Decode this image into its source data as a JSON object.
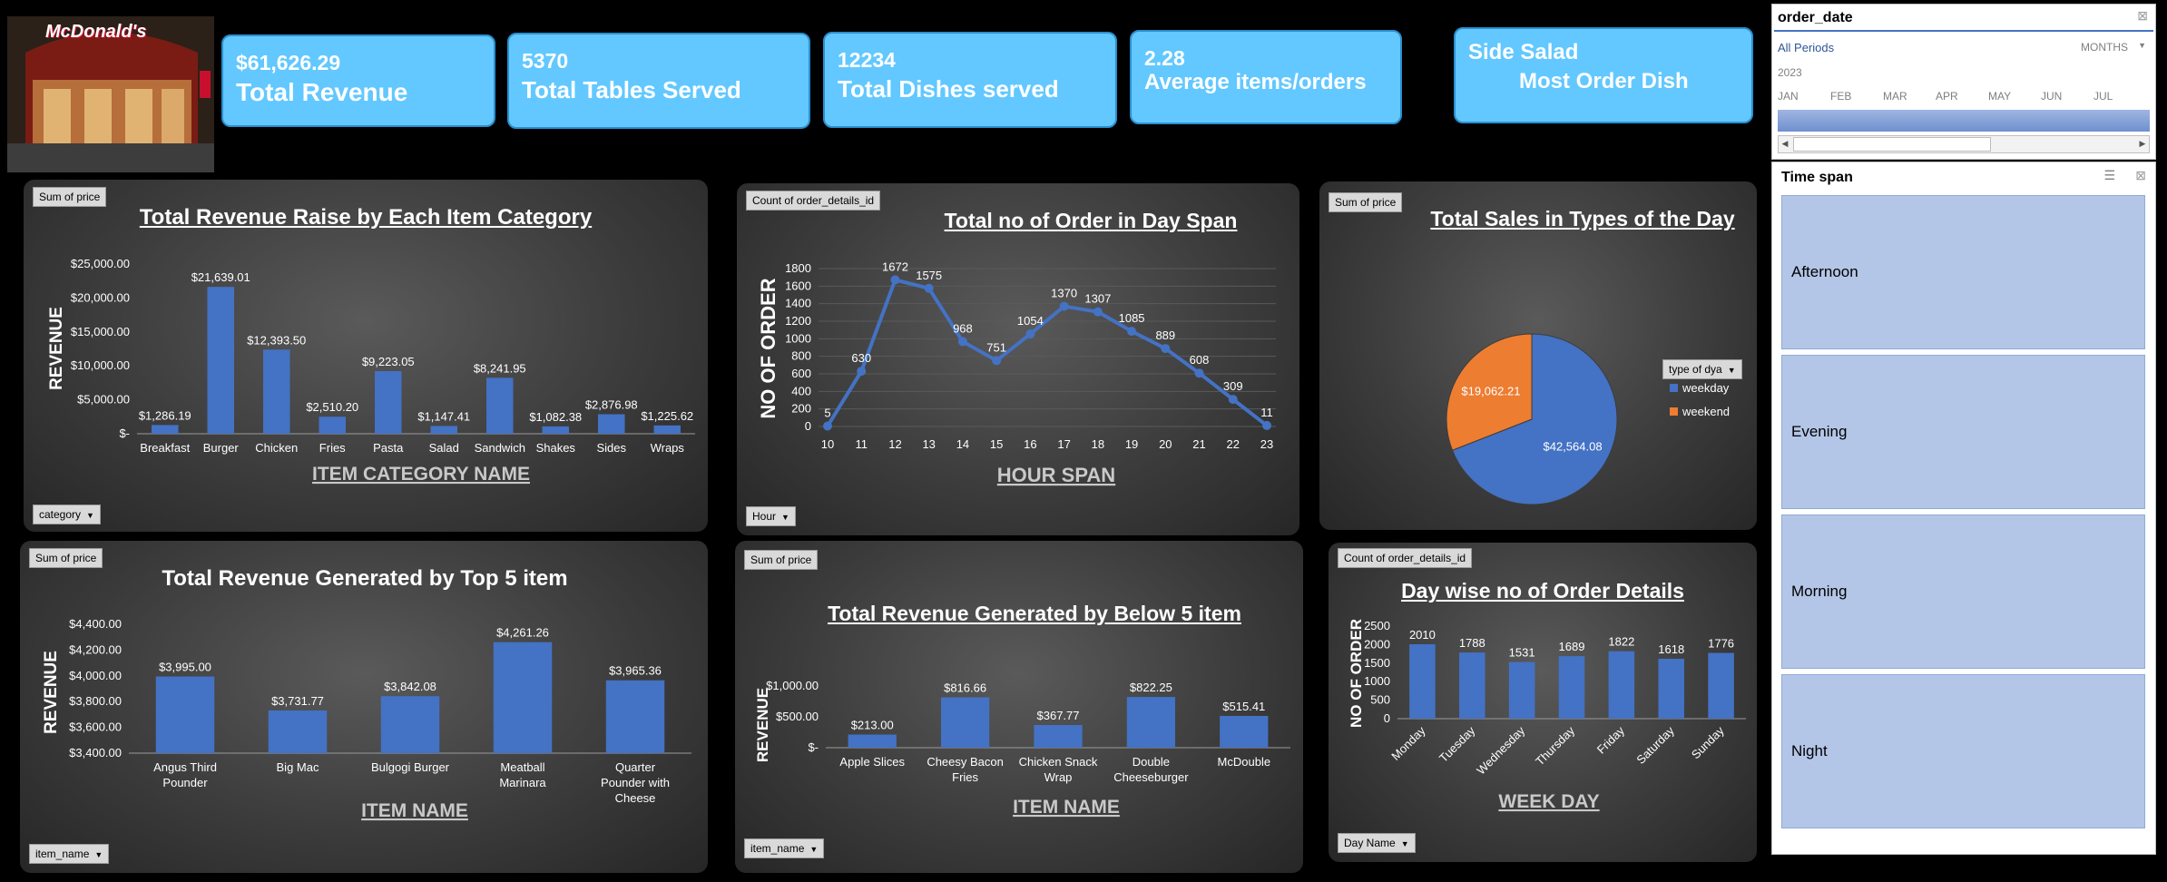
{
  "kpis": [
    {
      "value": "$61,626.29",
      "label": "Total Revenue"
    },
    {
      "value": "5370",
      "label": "Total Tables Served"
    },
    {
      "value": "12234",
      "label": "Total Dishes served"
    },
    {
      "value": "2.28",
      "label": "Average items/orders"
    },
    {
      "value": "Side Salad",
      "label": "Most Order Dish"
    }
  ],
  "logo_text": "McDonald's",
  "timeline": {
    "field": "order_date",
    "all_periods": "All Periods",
    "level": "MONTHS",
    "year": "2023",
    "months": [
      "JAN",
      "FEB",
      "MAR",
      "APR",
      "MAY",
      "JUN",
      "JUL"
    ]
  },
  "slicer": {
    "title": "Time span",
    "items": [
      "Afternoon",
      "Evening",
      "Morning",
      "Night"
    ]
  },
  "colors": {
    "bar": "#4472c4",
    "weekday": "#4472c4",
    "weekend": "#ed7d31",
    "kpi": "#62c8ff",
    "slicer_tile": "#b4c6e7"
  },
  "chart_data": [
    {
      "id": "category",
      "type": "bar",
      "field_button": "Sum of price",
      "axis_button": "category",
      "title": "Total Revenue  Raise by Each Item Category",
      "xlabel": "ITEM CATEGORY NAME",
      "ylabel": "REVENUE",
      "categories": [
        "Breakfast",
        "Burger",
        "Chicken",
        "Fries",
        "Pasta",
        "Salad",
        "Sandwich",
        "Shakes",
        "Sides",
        "Wraps"
      ],
      "values": [
        1286.19,
        21639.01,
        12393.5,
        2510.2,
        9223.05,
        1147.41,
        8241.95,
        1082.38,
        2876.98,
        1225.62
      ],
      "data_labels": [
        "$1,286.19",
        "$21,639.01",
        "$12,393.50",
        "$2,510.20",
        "$9,223.05",
        "$1,147.41",
        "$8,241.95",
        "$1,082.38",
        "$2,876.98",
        "$1,225.62"
      ],
      "yticks": [
        "$-",
        "$5,000.00",
        "$10,000.00",
        "$15,000.00",
        "$20,000.00",
        "$25,000.00"
      ],
      "ylim": [
        0,
        25000
      ]
    },
    {
      "id": "hour",
      "type": "line",
      "field_button": "Count of order_details_id",
      "axis_button": "Hour",
      "title": "Total no  of Order in Day Span",
      "xlabel": "HOUR SPAN",
      "ylabel": "NO OF ORDER",
      "x": [
        10,
        11,
        12,
        13,
        14,
        15,
        16,
        17,
        18,
        19,
        20,
        21,
        22,
        23
      ],
      "values": [
        5,
        630,
        1672,
        1575,
        968,
        751,
        1054,
        1370,
        1307,
        1085,
        889,
        608,
        309,
        11
      ],
      "yticks": [
        "0",
        "200",
        "400",
        "600",
        "800",
        "1000",
        "1200",
        "1400",
        "1600",
        "1800"
      ],
      "ylim": [
        0,
        1800
      ]
    },
    {
      "id": "daytype",
      "type": "pie",
      "field_button": "Sum of price",
      "title": "Total Sales  in Types of the Day",
      "legend_title": "type of dya",
      "legend_placement": "right",
      "categories": [
        "weekday",
        "weekend"
      ],
      "values": [
        42564.08,
        19062.21
      ],
      "data_labels": [
        "$42,564.08",
        "$19,062.21"
      ]
    },
    {
      "id": "top5",
      "type": "bar",
      "field_button": "Sum of price",
      "axis_button": "item_name",
      "title": "Total Revenue Generated by Top 5 item",
      "xlabel": "ITEM NAME",
      "ylabel": "REVENUE",
      "categories": [
        "Angus Third Pounder",
        "Big Mac",
        "Bulgogi Burger",
        "Meatball Marinara",
        "Quarter Pounder with Cheese"
      ],
      "values": [
        3995.0,
        3731.77,
        3842.08,
        4261.26,
        3965.36
      ],
      "data_labels": [
        "$3,995.00",
        "$3,731.77",
        "$3,842.08",
        "$4,261.26",
        "$3,965.36"
      ],
      "yticks": [
        "$3,400.00",
        "$3,600.00",
        "$3,800.00",
        "$4,000.00",
        "$4,200.00",
        "$4,400.00"
      ],
      "ylim": [
        3400,
        4400
      ]
    },
    {
      "id": "bottom5",
      "type": "bar",
      "field_button": "Sum of price",
      "axis_button": "item_name",
      "title": "Total Revenue Generated by Below 5 item",
      "xlabel": "ITEM NAME",
      "ylabel": "REVENUE",
      "categories": [
        "Apple Slices",
        "Cheesy Bacon Fries",
        "Chicken Snack Wrap",
        "Double Cheeseburger",
        "McDouble"
      ],
      "values": [
        213.0,
        816.66,
        367.77,
        822.25,
        515.41
      ],
      "data_labels": [
        "$213.00",
        "$816.66",
        "$367.77",
        "$822.25",
        "$515.41"
      ],
      "yticks": [
        "$-",
        "$500.00",
        "$1,000.00"
      ],
      "ylim": [
        0,
        1000
      ]
    },
    {
      "id": "weekday",
      "type": "bar",
      "field_button": "Count of order_details_id",
      "axis_button": "Day Name",
      "title": "Day wise no of Order Details",
      "xlabel": "WEEK DAY",
      "ylabel": "NO OF ORDER",
      "categories": [
        "Monday",
        "Tuesday",
        "Wednesday",
        "Thursday",
        "Friday",
        "Saturday",
        "Sunday"
      ],
      "values": [
        2010,
        1788,
        1531,
        1689,
        1822,
        1618,
        1776
      ],
      "yticks": [
        "0",
        "500",
        "1000",
        "1500",
        "2000",
        "2500"
      ],
      "ylim": [
        0,
        2500
      ]
    }
  ]
}
